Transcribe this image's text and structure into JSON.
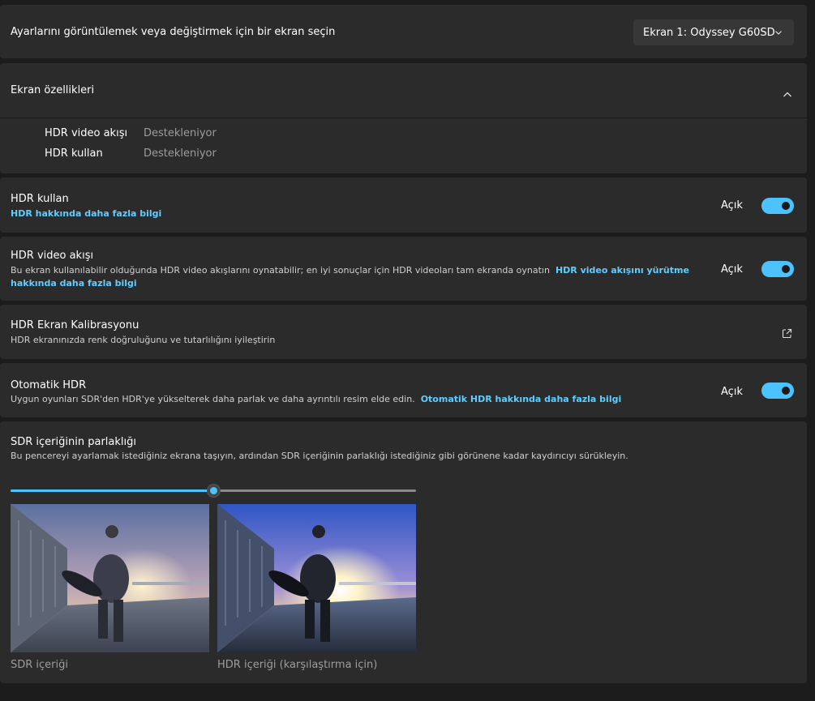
{
  "display_select": {
    "label": "Ayarlarını görüntülemek veya değiştirmek için bir ekran seçin",
    "selected": "Ekran 1: Odyssey G60SD"
  },
  "display_properties": {
    "title": "Ekran özellikleri",
    "items": [
      {
        "label": "HDR video akışı",
        "value": "Destekleniyor"
      },
      {
        "label": "HDR kullan",
        "value": "Destekleniyor"
      }
    ]
  },
  "use_hdr": {
    "title": "HDR kullan",
    "link": "HDR hakkında daha fazla bilgi",
    "state_label": "Açık",
    "on": true
  },
  "hdr_video": {
    "title": "HDR video akışı",
    "desc": "Bu ekran kullanılabilir olduğunda HDR video akışlarını oynatabilir; en iyi sonuçlar için HDR videoları tam ekranda oynatın",
    "link_part1": "HDR video akışını yürütme",
    "link_part2": "hakkında daha fazla bilgi",
    "state_label": "Açık",
    "on": true
  },
  "calibration": {
    "title": "HDR Ekran Kalibrasyonu",
    "desc": "HDR ekranınızda renk doğruluğunu ve tutarlılığını iyileştirin"
  },
  "auto_hdr": {
    "title": "Otomatik HDR",
    "desc": "Uygun oyunları SDR'den HDR'ye yükselterek daha parlak ve daha ayrıntılı resim elde edin.",
    "link": "Otomatik HDR hakkında daha fazla bilgi",
    "state_label": "Açık",
    "on": true
  },
  "sdr_brightness": {
    "title": "SDR içeriğinin parlaklığı",
    "desc": "Bu pencereyi ayarlamak istediğiniz ekrana taşıyın, ardından SDR içeriğinin parlaklığı istediğiniz gibi görünene kadar kaydırıcıyı sürükleyin.",
    "slider_fraction": 0.5,
    "sdr_caption": "SDR içeriği",
    "hdr_caption": "HDR içeriği (karşılaştırma için)"
  },
  "colors": {
    "accent": "#4cc2ff",
    "link": "#60cdff",
    "card": "#2b2b2b",
    "background": "#1c1c1c"
  },
  "icons": [
    "chevron-down-icon",
    "chevron-up-icon",
    "external-link-icon"
  ]
}
